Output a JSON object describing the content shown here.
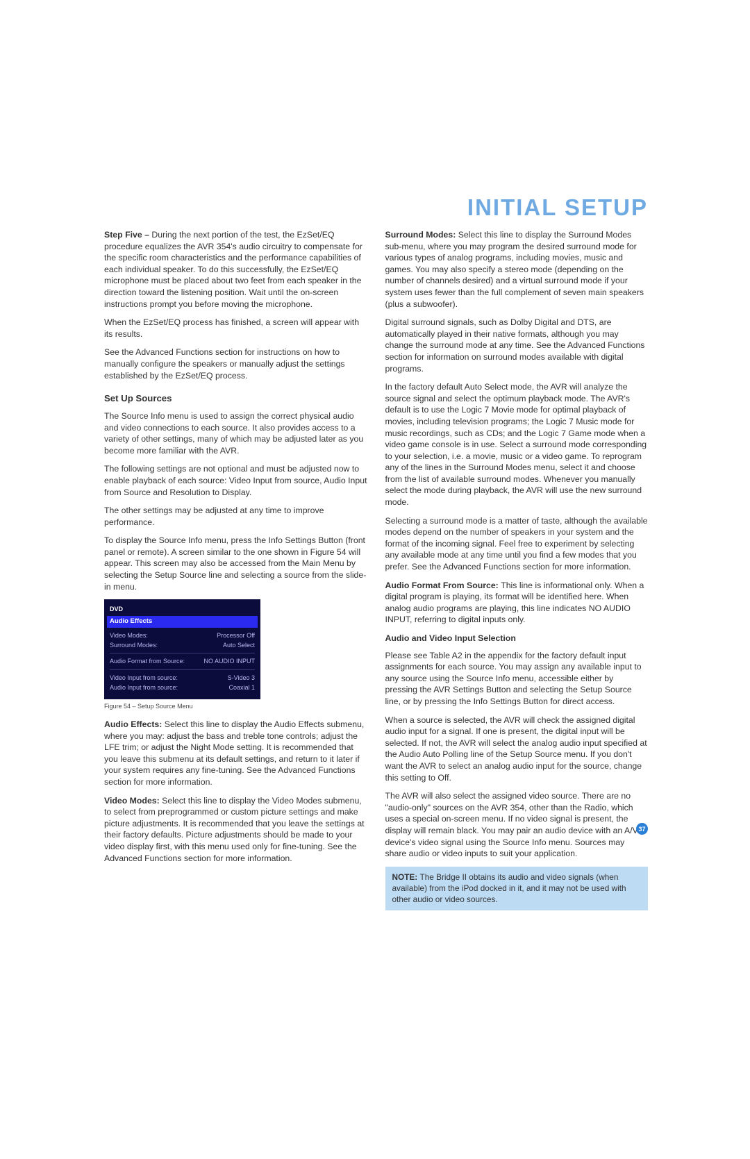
{
  "title": "INITIAL SETUP",
  "page_number": "37",
  "left": {
    "p1_lead": "Step Five – ",
    "p1": "During the next portion of the test, the EzSet/EQ procedure equalizes the AVR 354's audio circuitry to compensate for the specific room characteristics and the performance capabilities of each individual speaker. To do this successfully, the EzSet/EQ microphone must be placed about two feet from each speaker in the direction toward the listening position. Wait until the on-screen instructions prompt you before moving the microphone.",
    "p2": "When the EzSet/EQ process has finished, a screen will appear with its results.",
    "p3": "See the Advanced Functions section for instructions on how to manually configure the speakers or manually adjust the settings established by the EzSet/EQ process.",
    "heading": "Set Up Sources",
    "p4": "The Source Info menu is used to assign the correct physical audio and video connections to each source. It also provides access to a variety of other settings, many of which may be adjusted later as you become more familiar with the AVR.",
    "p5": "The following settings are not optional and must be adjusted now to enable playback of each source: Video Input from source, Audio Input from Source and Resolution to Display.",
    "p6": "The other settings may be adjusted at any time to improve performance.",
    "p7": "To display the Source Info menu, press the Info Settings Button (front panel or remote). A screen similar to the one shown in Figure 54 will appear. This screen may also be accessed from the Main Menu by selecting the Setup Source line and selecting a source from the slide-in menu.",
    "figure": {
      "title": "DVD",
      "section": "Audio Effects",
      "rows1": [
        {
          "label": "Video Modes:",
          "value": "Processor Off"
        },
        {
          "label": "Surround Modes:",
          "value": "Auto Select"
        }
      ],
      "rows2": [
        {
          "label": "Audio Format from Source:",
          "value": "NO AUDIO INPUT"
        }
      ],
      "rows3": [
        {
          "label": "Video Input from source:",
          "value": "S-Video 3"
        },
        {
          "label": "Audio Input from source:",
          "value": "Coaxial 1"
        }
      ]
    },
    "figure_caption": "Figure 54 – Setup Source Menu",
    "p8_lead": "Audio Effects: ",
    "p8": "Select this line to display the Audio Effects submenu, where you may: adjust the bass and treble tone controls; adjust the LFE trim; or adjust the Night Mode setting. It is recommended that you leave this submenu at its default settings, and return to it later if your system requires any fine-tuning. See the Advanced Functions section for more information.",
    "p9_lead": "Video Modes: ",
    "p9": "Select this line to display the Video Modes submenu, to select from preprogrammed or custom picture settings and make picture adjustments. It is recommended that you leave the settings at their factory defaults. Picture adjustments should be made to your video display first, with this menu used only for fine-tuning. See the Advanced Functions section for more information."
  },
  "right": {
    "p1_lead": "Surround Modes: ",
    "p1": "Select this line to display the Surround Modes sub-menu, where you may program the desired surround mode for various types of analog programs, including movies, music and games. You may also specify a stereo mode (depending on the number of channels desired) and a virtual surround mode if your system uses fewer than the full complement of seven main speakers (plus a subwoofer).",
    "p2": "Digital surround signals, such as Dolby Digital and DTS, are automatically played in their native formats, although you may change the surround mode at any time. See the Advanced Functions section for information on surround modes available with digital programs.",
    "p3": "In the factory default Auto Select mode, the AVR will analyze the source signal and select the optimum playback mode. The AVR's default is to use the Logic 7 Movie mode for optimal playback of movies, including television programs; the Logic 7 Music mode for music recordings, such as CDs; and the Logic 7 Game mode when a video game console is in use. Select a surround mode corresponding to your selection, i.e. a movie, music or a video game. To reprogram any of the lines in the Surround Modes menu, select it and choose from the list of available surround modes. Whenever you manually select the mode during playback, the AVR will use the new surround mode.",
    "p4": "Selecting a surround mode is a matter of taste, although the available modes depend on the number of speakers in your system and the format of the incoming signal. Feel free to experiment by selecting any available mode at any time until you find a few modes that you prefer. See the Advanced Functions section for more information.",
    "p5_lead": "Audio Format From Source: ",
    "p5": "This line is informational only. When a digital program is playing, its format will be identified here. When analog audio programs are playing, this line indicates NO AUDIO INPUT, referring to digital inputs only.",
    "subheading": "Audio and Video Input Selection",
    "p6": "Please see Table A2 in the appendix for the factory default input assignments for each source. You may assign any available input to any source using the Source Info menu, accessible either by pressing the AVR Settings Button and selecting the Setup Source line, or by pressing the Info Settings Button for direct access.",
    "p7": "When a source is selected, the AVR will check the assigned digital audio input for a signal. If one is present, the digital input will be selected. If not, the AVR will select the analog audio input specified at the Audio Auto Polling line of the Setup Source menu. If you don't want the AVR to select an analog audio input for the source, change this setting to Off.",
    "p8": "The AVR will also select the assigned video source. There are no \"audio-only\" sources on the AVR 354, other than the Radio, which uses a special on-screen menu. If no video signal is present, the display will remain black. You may pair an audio device with an A/V device's video signal using the Source Info menu. Sources may share audio or video inputs to suit your application.",
    "note_lead": "NOTE: ",
    "note": "The Bridge II obtains its audio and video signals (when available) from the iPod docked in it, and it may not be used with other audio or video sources."
  }
}
